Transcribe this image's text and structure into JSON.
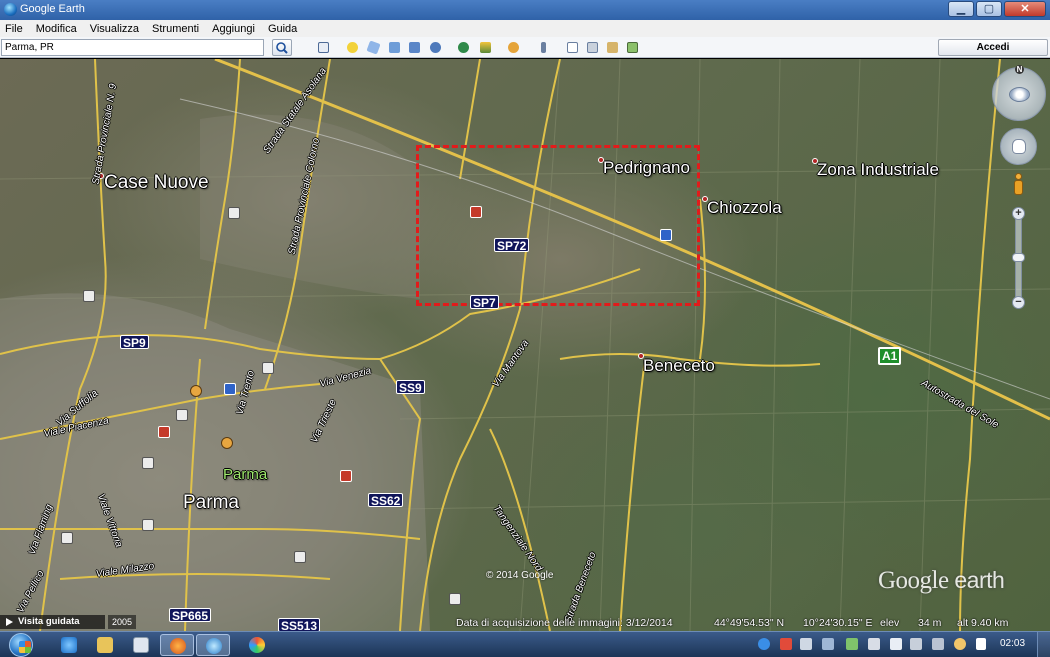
{
  "window": {
    "title": "Google Earth",
    "buttons": {
      "minimize": "▁",
      "maximize": "▢",
      "close": "✕"
    }
  },
  "menu": [
    "File",
    "Modifica",
    "Visualizza",
    "Strumenti",
    "Aggiungi",
    "Guida"
  ],
  "toolbar": {
    "search_value": "Parma, PR",
    "signin_label": "Accedi",
    "icons": [
      "search-icon",
      "sidebar-icon",
      "placemark-icon",
      "polygon-icon",
      "path-icon",
      "image-overlay-icon",
      "record-tour-icon",
      "historical-imagery-icon",
      "sunlight-icon",
      "planets-icon",
      "ruler-icon",
      "email-icon",
      "print-icon",
      "save-image-icon",
      "view-in-maps-icon"
    ]
  },
  "map": {
    "places": {
      "case_nuove": "Case Nuove",
      "pedrignano": "Pedrignano",
      "zona_industriale": "Zona Industriale",
      "chiozzola": "Chiozzola",
      "beneceto": "Beneceto",
      "parma": "Parma",
      "parma_green": "Parma"
    },
    "road_shields": {
      "sp72": "SP72",
      "sp7": "SP7",
      "sp9": "SP9",
      "ss9": "SS9",
      "ss62": "SS62",
      "sp665": "SP665",
      "ss513": "SS513",
      "a1": "A1"
    },
    "road_labels": {
      "sp_n9": "Strada Provinciale N. 9",
      "strada_statale_asolana": "Strada Statale Asolana",
      "strada_provinciale_colorno": "Strada Provinciale Colorno",
      "via_mantova": "Via Mantova",
      "via_venezia": "Via Venezia",
      "via_trieste": "Via Trieste",
      "via_trento": "Via Trento",
      "via_burla": "Via Burla",
      "via_suffolia": "Via Suffolia",
      "viale_piacenza": "Viale Piacenza",
      "via_emilio_lepido": "Tangenziale Nord",
      "via_flaminia": "Via Flaming",
      "viale_vittoria": "Viale Vittoria",
      "viale_milazzo": "Viale Milazzo",
      "via_pellico": "Via Pellico",
      "autostrada_del_sole": "Autostrada del Sole",
      "strada_beneceto": "Strada Beneceto"
    },
    "copyright": "© 2014 Google",
    "logo_google": "Google",
    "logo_earth": "earth",
    "nav_north": "N",
    "zoom_in": "+",
    "zoom_out": "−",
    "selection_color": "#e21b1b"
  },
  "status": {
    "tour_label": "Visita guidata",
    "year": "2005",
    "imagery_date": "Data di acquisizione delle immagini: 3/12/2014",
    "lat": "44°49'54.53\" N",
    "lon": "10°24'30.15\" E",
    "elev": "34 m",
    "alt": "alt   9.40 km"
  },
  "taskbar": {
    "clock": "02:03",
    "items": [
      "ie-icon",
      "explorer-icon",
      "media-player-icon",
      "firefox-icon",
      "google-earth-icon",
      "paint-icon"
    ],
    "tray": [
      "skype-icon",
      "pdf-icon",
      "volume-icon",
      "network-icon",
      "battery-icon",
      "flag-icon",
      "printer-icon",
      "usb-icon",
      "notification-icon",
      "signal-icon"
    ]
  }
}
